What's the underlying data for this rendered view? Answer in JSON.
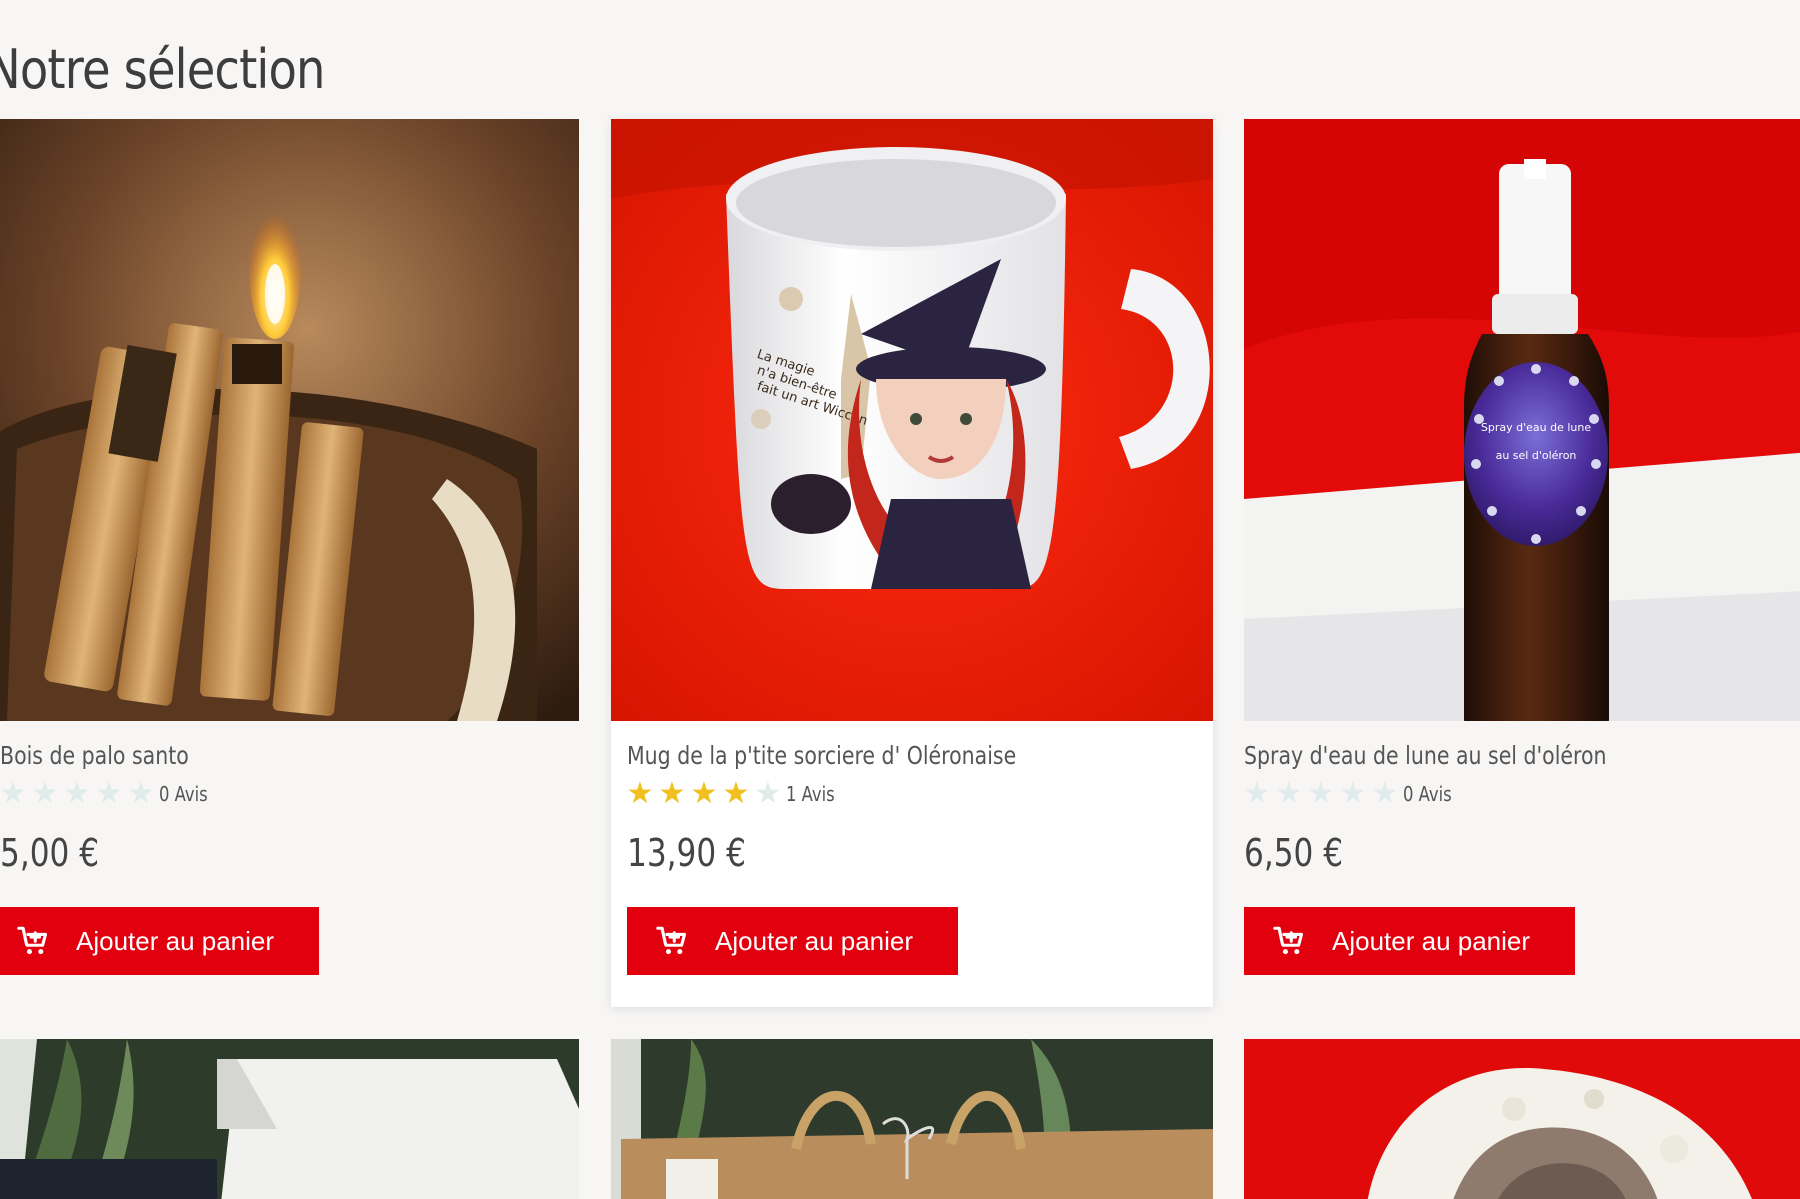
{
  "section": {
    "title": "Notre sélection"
  },
  "products": [
    {
      "name": "Bois de palo santo",
      "rating": 0,
      "reviews_label": "0 Avis",
      "price": "5,00 €",
      "cart_label": "Ajouter au panier"
    },
    {
      "name": "Mug de la p'tite sorciere d' Oléronaise",
      "rating": 4,
      "reviews_label": "1 Avis",
      "price": "13,90 €",
      "cart_label": "Ajouter au panier",
      "image_text": "La magie n'a bien-être fait un art Wiccan"
    },
    {
      "name": "Spray d'eau de lune au sel d'oléron",
      "rating": 0,
      "reviews_label": "0 Avis",
      "price": "6,50 €",
      "cart_label": "Ajouter au panier",
      "image_text_line1": "Spray d'eau de lune",
      "image_text_line2": "au sel d'oléron"
    }
  ],
  "colors": {
    "accent": "#e2000f",
    "star_on": "#f2c01e",
    "star_off": "#dfeceb",
    "background": "#f7f6f5"
  },
  "icons": {
    "cart": "cart-plus-icon",
    "star": "star-icon"
  }
}
